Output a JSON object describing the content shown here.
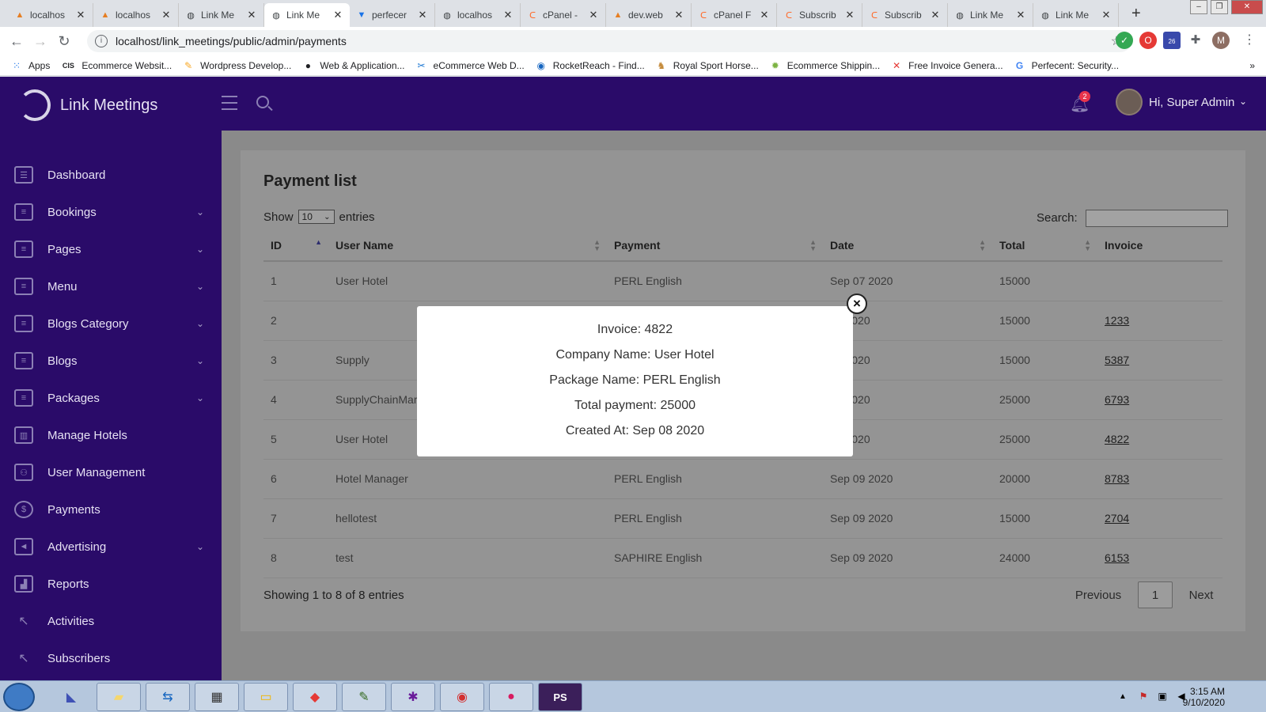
{
  "browser": {
    "tabs": [
      {
        "title": "localhos",
        "active": false
      },
      {
        "title": "localhos",
        "active": false
      },
      {
        "title": "Link Me",
        "active": false
      },
      {
        "title": "Link Me",
        "active": true
      },
      {
        "title": "perfecer",
        "active": false
      },
      {
        "title": "localhos",
        "active": false
      },
      {
        "title": "cPanel -",
        "active": false
      },
      {
        "title": "dev.web",
        "active": false
      },
      {
        "title": "cPanel F",
        "active": false
      },
      {
        "title": "Subscrib",
        "active": false
      },
      {
        "title": "Subscrib",
        "active": false
      },
      {
        "title": "Link Me",
        "active": false
      },
      {
        "title": "Link Me",
        "active": false
      }
    ],
    "url": "localhost/link_meetings/public/admin/payments",
    "profile_initial": "M",
    "ext_badge": "26",
    "bookmarks": [
      "Apps",
      "Ecommerce Websit...",
      "Wordpress Develop...",
      "Web & Application...",
      "eCommerce Web D...",
      "RocketReach - Find...",
      "Royal Sport Horse...",
      "Ecommerce Shippin...",
      "Free Invoice Genera...",
      "Perfecent: Security..."
    ],
    "bookmark_icons": {
      "cis": "CIS"
    },
    "more_bookmarks": "»"
  },
  "app": {
    "brand": "Link Meetings",
    "notifications_count": "2",
    "greeting": "Hi, Super Admin",
    "colors": {
      "sidebar": "#2a0b69",
      "accent": "#e8344c"
    }
  },
  "sidebar": {
    "items": [
      {
        "label": "Dashboard",
        "has_submenu": false
      },
      {
        "label": "Bookings",
        "has_submenu": true
      },
      {
        "label": "Pages",
        "has_submenu": true
      },
      {
        "label": "Menu",
        "has_submenu": true
      },
      {
        "label": "Blogs Category",
        "has_submenu": true
      },
      {
        "label": "Blogs",
        "has_submenu": true
      },
      {
        "label": "Packages",
        "has_submenu": true
      },
      {
        "label": "Manage Hotels",
        "has_submenu": false
      },
      {
        "label": "User Management",
        "has_submenu": false
      },
      {
        "label": "Payments",
        "has_submenu": false
      },
      {
        "label": "Advertising",
        "has_submenu": true
      },
      {
        "label": "Reports",
        "has_submenu": false
      },
      {
        "label": "Activities",
        "has_submenu": false
      },
      {
        "label": "Subscribers",
        "has_submenu": false
      }
    ]
  },
  "main": {
    "title": "Payment list",
    "show_label": "Show",
    "entries_label": "entries",
    "page_size": "10",
    "search_label": "Search:",
    "search_value": "",
    "columns": [
      "ID",
      "User Name",
      "Payment",
      "Date",
      "Total",
      "Invoice"
    ],
    "rows": [
      {
        "id": "1",
        "user": "User Hotel",
        "payment": "PERL English",
        "date": "Sep 07 2020",
        "total": "15000",
        "invoice": ""
      },
      {
        "id": "2",
        "user": "",
        "payment": "",
        "date": "07 2020",
        "total": "15000",
        "invoice": "1233"
      },
      {
        "id": "3",
        "user": "Supply",
        "payment": "",
        "date": "07 2020",
        "total": "15000",
        "invoice": "5387"
      },
      {
        "id": "4",
        "user": "SupplyChainMar",
        "payment": "",
        "date": "07 2020",
        "total": "25000",
        "invoice": "6793"
      },
      {
        "id": "5",
        "user": "User Hotel",
        "payment": "",
        "date": "08 2020",
        "total": "25000",
        "invoice": "4822"
      },
      {
        "id": "6",
        "user": "Hotel Manager",
        "payment": "PERL English",
        "date": "Sep 09 2020",
        "total": "20000",
        "invoice": "8783"
      },
      {
        "id": "7",
        "user": "hellotest",
        "payment": "PERL English",
        "date": "Sep 09 2020",
        "total": "15000",
        "invoice": "2704"
      },
      {
        "id": "8",
        "user": "test",
        "payment": "SAPHIRE English",
        "date": "Sep 09 2020",
        "total": "24000",
        "invoice": "6153"
      }
    ],
    "showing": "Showing 1 to 8 of 8 entries",
    "pagination": {
      "previous": "Previous",
      "current": "1",
      "next": "Next"
    }
  },
  "modal": {
    "lines": [
      "Invoice: 4822",
      "Company Name: User Hotel",
      "Package Name: PERL English",
      "Total payment: 25000",
      "Created At: Sep 08 2020"
    ],
    "close_glyph": "×"
  },
  "taskbar": {
    "time": "3:15 AM",
    "date": "9/10/2020",
    "ps_label": "PS"
  }
}
